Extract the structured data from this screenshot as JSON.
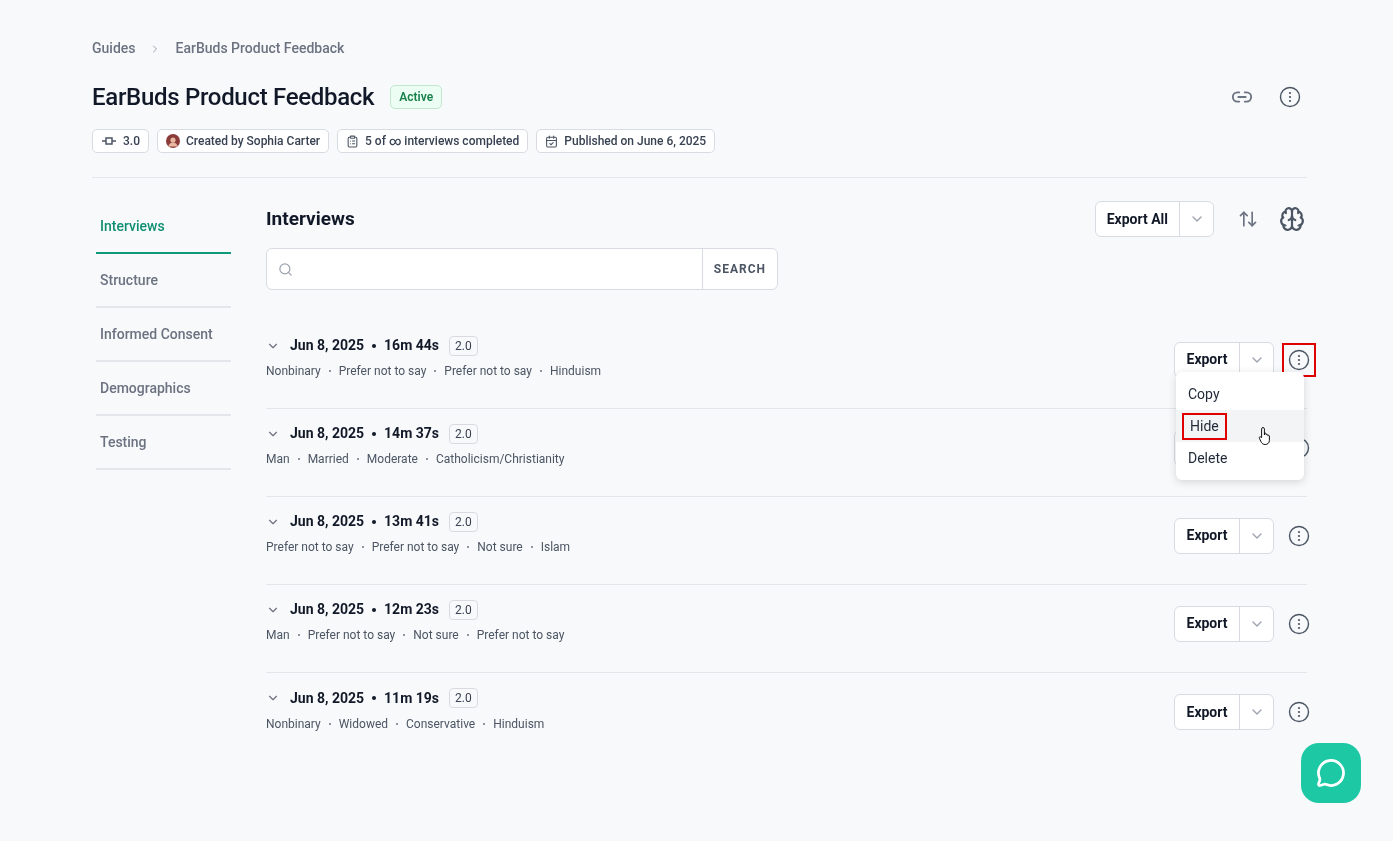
{
  "breadcrumb": [
    "Guides",
    "EarBuds Product Feedback"
  ],
  "title": "EarBuds Product Feedback",
  "status": "Active",
  "chips": [
    {
      "kind": "version",
      "label": "3.0"
    },
    {
      "kind": "author",
      "label": "Created by Sophia Carter"
    },
    {
      "kind": "progress",
      "label": "5 of ∞ interviews completed"
    },
    {
      "kind": "published",
      "label": "Published on June 6, 2025"
    }
  ],
  "sidebar": {
    "items": [
      {
        "label": "Interviews",
        "selected": true
      },
      {
        "label": "Structure",
        "selected": false
      },
      {
        "label": "Informed Consent",
        "selected": false
      },
      {
        "label": "Demographics",
        "selected": false
      },
      {
        "label": "Testing",
        "selected": false
      }
    ]
  },
  "section_title": "Interviews",
  "export_all": "Export All",
  "search": {
    "button": "SEARCH"
  },
  "interviews": [
    {
      "date": "Jun 8, 2025",
      "duration": "16m 44s",
      "version": "2.0",
      "tags": [
        "Nonbinary",
        "Prefer not to say",
        "Prefer not to say",
        "Hinduism"
      ],
      "export": "Export",
      "menu_highlighted": true
    },
    {
      "date": "Jun 8, 2025",
      "duration": "14m 37s",
      "version": "2.0",
      "tags": [
        "Man",
        "Married",
        "Moderate",
        "Catholicism/Christianity"
      ],
      "menu_highlighted": false
    },
    {
      "date": "Jun 8, 2025",
      "duration": "13m 41s",
      "version": "2.0",
      "tags": [
        "Prefer not to say",
        "Prefer not to say",
        "Not sure",
        "Islam"
      ],
      "export": "Export",
      "menu_highlighted": false
    },
    {
      "date": "Jun 8, 2025",
      "duration": "12m 23s",
      "version": "2.0",
      "tags": [
        "Man",
        "Prefer not to say",
        "Not sure",
        "Prefer not to say"
      ],
      "export": "Export",
      "menu_highlighted": false
    },
    {
      "date": "Jun 8, 2025",
      "duration": "11m 19s",
      "version": "2.0",
      "tags": [
        "Nonbinary",
        "Widowed",
        "Conservative",
        "Hinduism"
      ],
      "export": "Export",
      "menu_highlighted": false
    }
  ],
  "menu": {
    "items": [
      {
        "label": "Copy",
        "highlighted": false,
        "hovered": false
      },
      {
        "label": "Hide",
        "highlighted": true,
        "hovered": true
      },
      {
        "label": "Delete",
        "highlighted": false,
        "hovered": false
      }
    ]
  }
}
